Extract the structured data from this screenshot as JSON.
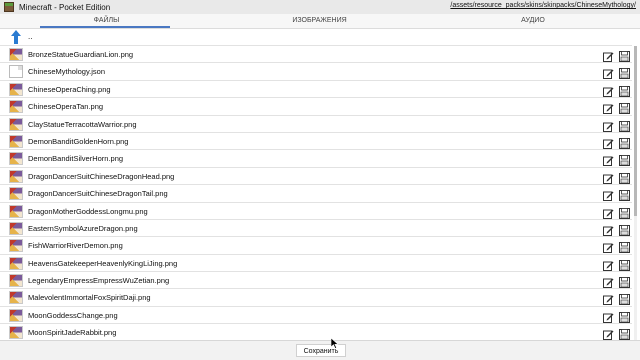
{
  "window": {
    "title": "Minecraft - Pocket Edition",
    "path": "/assets/resource_packs/skins/skinpacks/ChineseMythology/"
  },
  "tabs": [
    {
      "label": "ФАЙЛЫ",
      "active": true
    },
    {
      "label": "ИЗОБРАЖЕНИЯ",
      "active": false
    },
    {
      "label": "АУДИО",
      "active": false
    }
  ],
  "up": {
    "label": "..",
    "icon": "arrow-up-icon"
  },
  "files": [
    {
      "name": "BronzeStatueGuardianLion.png",
      "type": "png"
    },
    {
      "name": "ChineseMythology.json",
      "type": "json"
    },
    {
      "name": "ChineseOperaChing.png",
      "type": "png"
    },
    {
      "name": "ChineseOperaTan.png",
      "type": "png"
    },
    {
      "name": "ClayStatueTerracottaWarrior.png",
      "type": "png"
    },
    {
      "name": "DemonBanditGoldenHorn.png",
      "type": "png"
    },
    {
      "name": "DemonBanditSilverHorn.png",
      "type": "png"
    },
    {
      "name": "DragonDancerSuitChineseDragonHead.png",
      "type": "png"
    },
    {
      "name": "DragonDancerSuitChineseDragonTail.png",
      "type": "png"
    },
    {
      "name": "DragonMotherGoddessLongmu.png",
      "type": "png"
    },
    {
      "name": "EasternSymbolAzureDragon.png",
      "type": "png"
    },
    {
      "name": "FishWarriorRiverDemon.png",
      "type": "png"
    },
    {
      "name": "HeavensGatekeeperHeavenlyKingLiJing.png",
      "type": "png"
    },
    {
      "name": "LegendaryEmpressEmpressWuZetian.png",
      "type": "png"
    },
    {
      "name": "MalevolentImmortalFoxSpiritDaji.png",
      "type": "png"
    },
    {
      "name": "MoonGoddessChange.png",
      "type": "png"
    },
    {
      "name": "MoonSpiritJadeRabbit.png",
      "type": "png"
    }
  ],
  "row_actions": {
    "edit_icon": "edit-icon",
    "save_icon": "save-disk-icon"
  },
  "bottom": {
    "save_label": "Сохранить"
  },
  "colors": {
    "accent": "#4a78c2",
    "titlebar": "#e9e9e9",
    "up_arrow": "#2a7bd1"
  }
}
